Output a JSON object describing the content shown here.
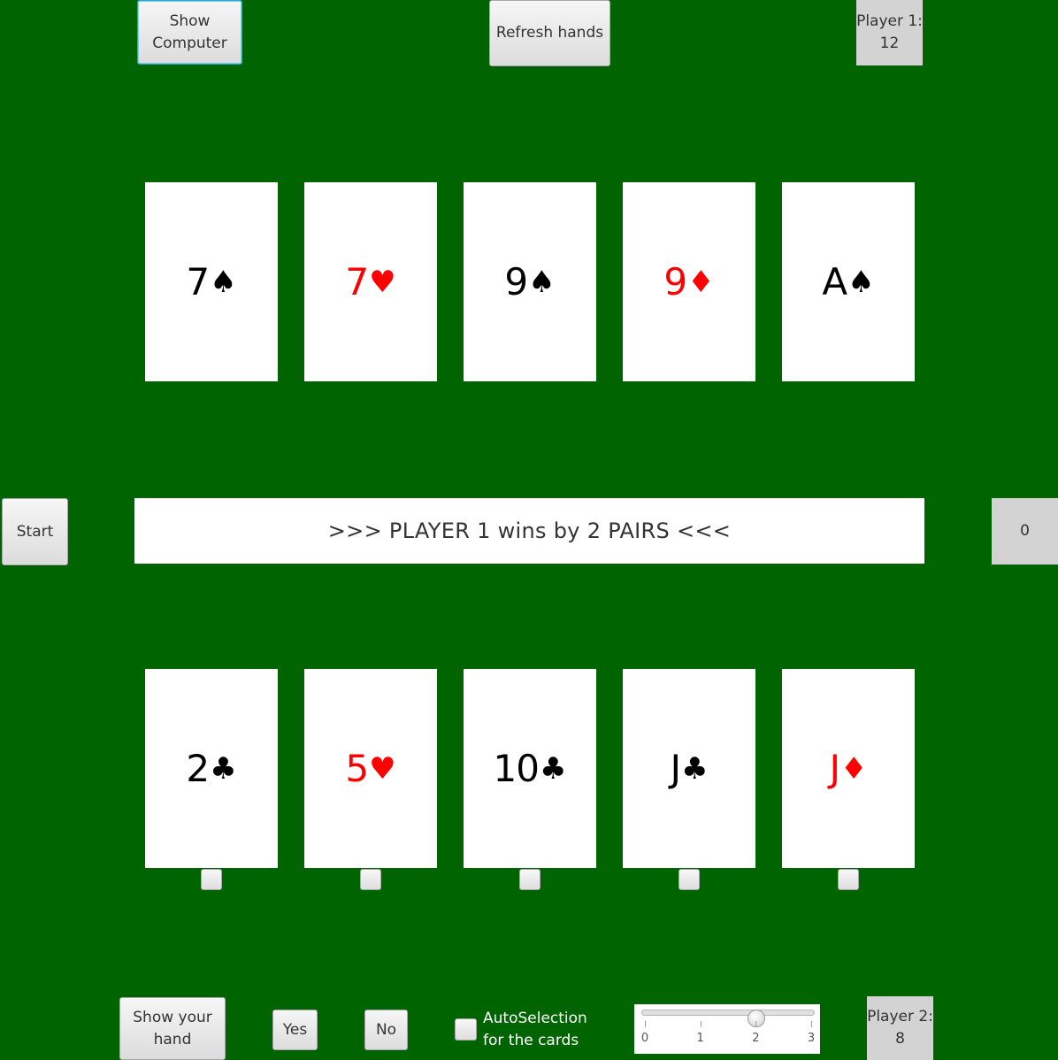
{
  "top_bar": {
    "show_computer_label_line1": "Show",
    "show_computer_label_line2": "Computer",
    "refresh_hands_label": "Refresh hands",
    "player1_score_label": "Player 1:",
    "player1_score_value": "12"
  },
  "computer_hand": [
    {
      "rank": "7",
      "suit": "♠",
      "color": "black"
    },
    {
      "rank": "7",
      "suit": "♥",
      "color": "red"
    },
    {
      "rank": "9",
      "suit": "♠",
      "color": "black"
    },
    {
      "rank": "9",
      "suit": "♦",
      "color": "red"
    },
    {
      "rank": "A",
      "suit": "♠",
      "color": "black"
    }
  ],
  "middle": {
    "start_label": "Start",
    "message": ">>> PLAYER 1 wins by 2 PAIRS <<<",
    "counter_value": "0"
  },
  "player_hand": [
    {
      "rank": "2",
      "suit": "♣",
      "color": "black"
    },
    {
      "rank": "5",
      "suit": "♥",
      "color": "red"
    },
    {
      "rank": "10",
      "suit": "♣",
      "color": "black"
    },
    {
      "rank": "J",
      "suit": "♣",
      "color": "black"
    },
    {
      "rank": "J",
      "suit": "♦",
      "color": "red"
    }
  ],
  "bottom_bar": {
    "show_hand_label_line1": "Show your",
    "show_hand_label_line2": "hand",
    "yes_label": "Yes",
    "no_label": "No",
    "auto_selection_line1": "AutoSelection",
    "auto_selection_line2": "for the cards",
    "slider": {
      "min": 0,
      "max": 3,
      "value": 2,
      "ticks": [
        "0",
        "1",
        "2",
        "3"
      ]
    },
    "player2_score_label": "Player 2:",
    "player2_score_value": "8"
  },
  "colors": {
    "table_green": "#006400",
    "red_suit": "#ff0000",
    "black_suit": "#000000",
    "score_box": "#d3d3d3"
  }
}
